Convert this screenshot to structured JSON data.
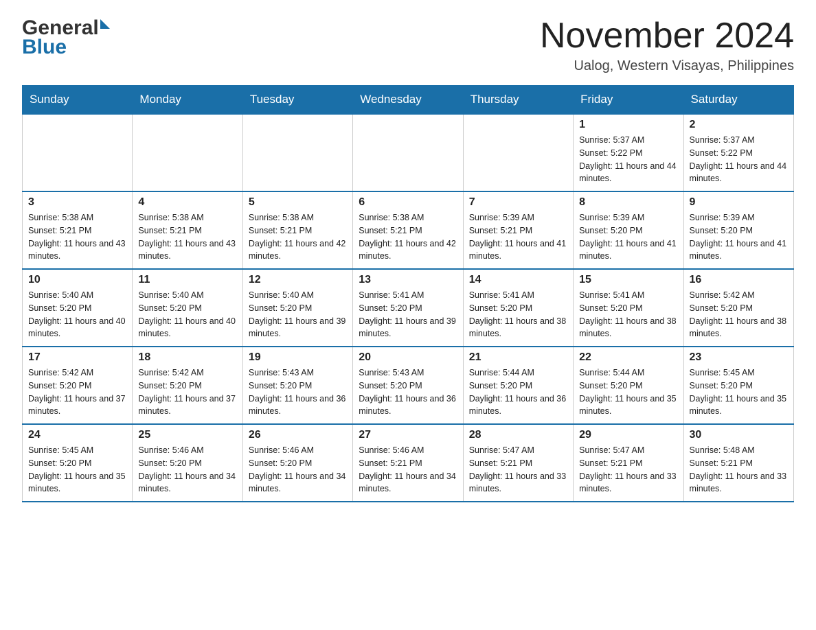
{
  "header": {
    "logo_general": "General",
    "logo_blue": "Blue",
    "month_title": "November 2024",
    "location": "Ualog, Western Visayas, Philippines"
  },
  "weekdays": [
    "Sunday",
    "Monday",
    "Tuesday",
    "Wednesday",
    "Thursday",
    "Friday",
    "Saturday"
  ],
  "weeks": [
    [
      {
        "day": "",
        "sunrise": "",
        "sunset": "",
        "daylight": ""
      },
      {
        "day": "",
        "sunrise": "",
        "sunset": "",
        "daylight": ""
      },
      {
        "day": "",
        "sunrise": "",
        "sunset": "",
        "daylight": ""
      },
      {
        "day": "",
        "sunrise": "",
        "sunset": "",
        "daylight": ""
      },
      {
        "day": "",
        "sunrise": "",
        "sunset": "",
        "daylight": ""
      },
      {
        "day": "1",
        "sunrise": "Sunrise: 5:37 AM",
        "sunset": "Sunset: 5:22 PM",
        "daylight": "Daylight: 11 hours and 44 minutes."
      },
      {
        "day": "2",
        "sunrise": "Sunrise: 5:37 AM",
        "sunset": "Sunset: 5:22 PM",
        "daylight": "Daylight: 11 hours and 44 minutes."
      }
    ],
    [
      {
        "day": "3",
        "sunrise": "Sunrise: 5:38 AM",
        "sunset": "Sunset: 5:21 PM",
        "daylight": "Daylight: 11 hours and 43 minutes."
      },
      {
        "day": "4",
        "sunrise": "Sunrise: 5:38 AM",
        "sunset": "Sunset: 5:21 PM",
        "daylight": "Daylight: 11 hours and 43 minutes."
      },
      {
        "day": "5",
        "sunrise": "Sunrise: 5:38 AM",
        "sunset": "Sunset: 5:21 PM",
        "daylight": "Daylight: 11 hours and 42 minutes."
      },
      {
        "day": "6",
        "sunrise": "Sunrise: 5:38 AM",
        "sunset": "Sunset: 5:21 PM",
        "daylight": "Daylight: 11 hours and 42 minutes."
      },
      {
        "day": "7",
        "sunrise": "Sunrise: 5:39 AM",
        "sunset": "Sunset: 5:21 PM",
        "daylight": "Daylight: 11 hours and 41 minutes."
      },
      {
        "day": "8",
        "sunrise": "Sunrise: 5:39 AM",
        "sunset": "Sunset: 5:20 PM",
        "daylight": "Daylight: 11 hours and 41 minutes."
      },
      {
        "day": "9",
        "sunrise": "Sunrise: 5:39 AM",
        "sunset": "Sunset: 5:20 PM",
        "daylight": "Daylight: 11 hours and 41 minutes."
      }
    ],
    [
      {
        "day": "10",
        "sunrise": "Sunrise: 5:40 AM",
        "sunset": "Sunset: 5:20 PM",
        "daylight": "Daylight: 11 hours and 40 minutes."
      },
      {
        "day": "11",
        "sunrise": "Sunrise: 5:40 AM",
        "sunset": "Sunset: 5:20 PM",
        "daylight": "Daylight: 11 hours and 40 minutes."
      },
      {
        "day": "12",
        "sunrise": "Sunrise: 5:40 AM",
        "sunset": "Sunset: 5:20 PM",
        "daylight": "Daylight: 11 hours and 39 minutes."
      },
      {
        "day": "13",
        "sunrise": "Sunrise: 5:41 AM",
        "sunset": "Sunset: 5:20 PM",
        "daylight": "Daylight: 11 hours and 39 minutes."
      },
      {
        "day": "14",
        "sunrise": "Sunrise: 5:41 AM",
        "sunset": "Sunset: 5:20 PM",
        "daylight": "Daylight: 11 hours and 38 minutes."
      },
      {
        "day": "15",
        "sunrise": "Sunrise: 5:41 AM",
        "sunset": "Sunset: 5:20 PM",
        "daylight": "Daylight: 11 hours and 38 minutes."
      },
      {
        "day": "16",
        "sunrise": "Sunrise: 5:42 AM",
        "sunset": "Sunset: 5:20 PM",
        "daylight": "Daylight: 11 hours and 38 minutes."
      }
    ],
    [
      {
        "day": "17",
        "sunrise": "Sunrise: 5:42 AM",
        "sunset": "Sunset: 5:20 PM",
        "daylight": "Daylight: 11 hours and 37 minutes."
      },
      {
        "day": "18",
        "sunrise": "Sunrise: 5:42 AM",
        "sunset": "Sunset: 5:20 PM",
        "daylight": "Daylight: 11 hours and 37 minutes."
      },
      {
        "day": "19",
        "sunrise": "Sunrise: 5:43 AM",
        "sunset": "Sunset: 5:20 PM",
        "daylight": "Daylight: 11 hours and 36 minutes."
      },
      {
        "day": "20",
        "sunrise": "Sunrise: 5:43 AM",
        "sunset": "Sunset: 5:20 PM",
        "daylight": "Daylight: 11 hours and 36 minutes."
      },
      {
        "day": "21",
        "sunrise": "Sunrise: 5:44 AM",
        "sunset": "Sunset: 5:20 PM",
        "daylight": "Daylight: 11 hours and 36 minutes."
      },
      {
        "day": "22",
        "sunrise": "Sunrise: 5:44 AM",
        "sunset": "Sunset: 5:20 PM",
        "daylight": "Daylight: 11 hours and 35 minutes."
      },
      {
        "day": "23",
        "sunrise": "Sunrise: 5:45 AM",
        "sunset": "Sunset: 5:20 PM",
        "daylight": "Daylight: 11 hours and 35 minutes."
      }
    ],
    [
      {
        "day": "24",
        "sunrise": "Sunrise: 5:45 AM",
        "sunset": "Sunset: 5:20 PM",
        "daylight": "Daylight: 11 hours and 35 minutes."
      },
      {
        "day": "25",
        "sunrise": "Sunrise: 5:46 AM",
        "sunset": "Sunset: 5:20 PM",
        "daylight": "Daylight: 11 hours and 34 minutes."
      },
      {
        "day": "26",
        "sunrise": "Sunrise: 5:46 AM",
        "sunset": "Sunset: 5:20 PM",
        "daylight": "Daylight: 11 hours and 34 minutes."
      },
      {
        "day": "27",
        "sunrise": "Sunrise: 5:46 AM",
        "sunset": "Sunset: 5:21 PM",
        "daylight": "Daylight: 11 hours and 34 minutes."
      },
      {
        "day": "28",
        "sunrise": "Sunrise: 5:47 AM",
        "sunset": "Sunset: 5:21 PM",
        "daylight": "Daylight: 11 hours and 33 minutes."
      },
      {
        "day": "29",
        "sunrise": "Sunrise: 5:47 AM",
        "sunset": "Sunset: 5:21 PM",
        "daylight": "Daylight: 11 hours and 33 minutes."
      },
      {
        "day": "30",
        "sunrise": "Sunrise: 5:48 AM",
        "sunset": "Sunset: 5:21 PM",
        "daylight": "Daylight: 11 hours and 33 minutes."
      }
    ]
  ]
}
